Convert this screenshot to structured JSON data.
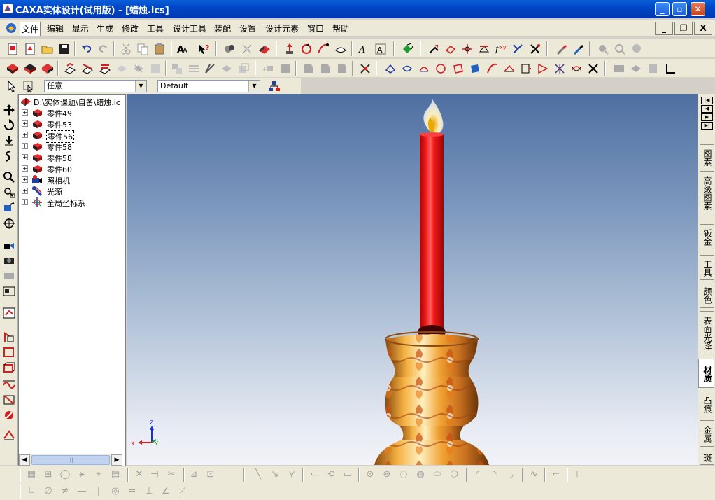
{
  "window": {
    "title": "CAXA实体设计(试用版) - [蜡烛.ics]",
    "minimize": "_",
    "restore": "▫",
    "close": "✕"
  },
  "menu": {
    "items": [
      "文件",
      "编辑",
      "显示",
      "生成",
      "修改",
      "工具",
      "设计工具",
      "装配",
      "设置",
      "设计元素",
      "窗口",
      "帮助"
    ],
    "mdi_minimize": "_",
    "mdi_restore": "❐",
    "mdi_close": "X"
  },
  "selector": {
    "filter_value": "任意",
    "style_value": "Default"
  },
  "tree": {
    "root": "D:\\实体课题\\自备\\蜡烛.ic",
    "items": [
      {
        "label": "零件49",
        "icon": "part-icon"
      },
      {
        "label": "零件53",
        "icon": "part-icon"
      },
      {
        "label": "零件56",
        "icon": "part-icon",
        "selected": true
      },
      {
        "label": "零件58",
        "icon": "part-icon"
      },
      {
        "label": "零件58",
        "icon": "part-icon"
      },
      {
        "label": "零件60",
        "icon": "part-icon"
      },
      {
        "label": "照相机",
        "icon": "camera-icon"
      },
      {
        "label": "光源",
        "icon": "light-icon"
      },
      {
        "label": "全局坐标系",
        "icon": "coordinate-system-icon"
      }
    ]
  },
  "right_tabs": [
    "图素",
    "高级图素",
    "钣金",
    "工具",
    "颜色",
    "表面光泽",
    "材质",
    "凸痕",
    "金属",
    "斑"
  ],
  "right_tabs_active": "材质",
  "axes": {
    "x": "X",
    "y": "Y",
    "z": "Z"
  },
  "colors": {
    "titlebar": "#0047c8",
    "candle": "#e8141a",
    "flame": "#f7c228",
    "viewport_top": "#4e6fa2",
    "viewport_bottom": "#f2f3f8"
  }
}
